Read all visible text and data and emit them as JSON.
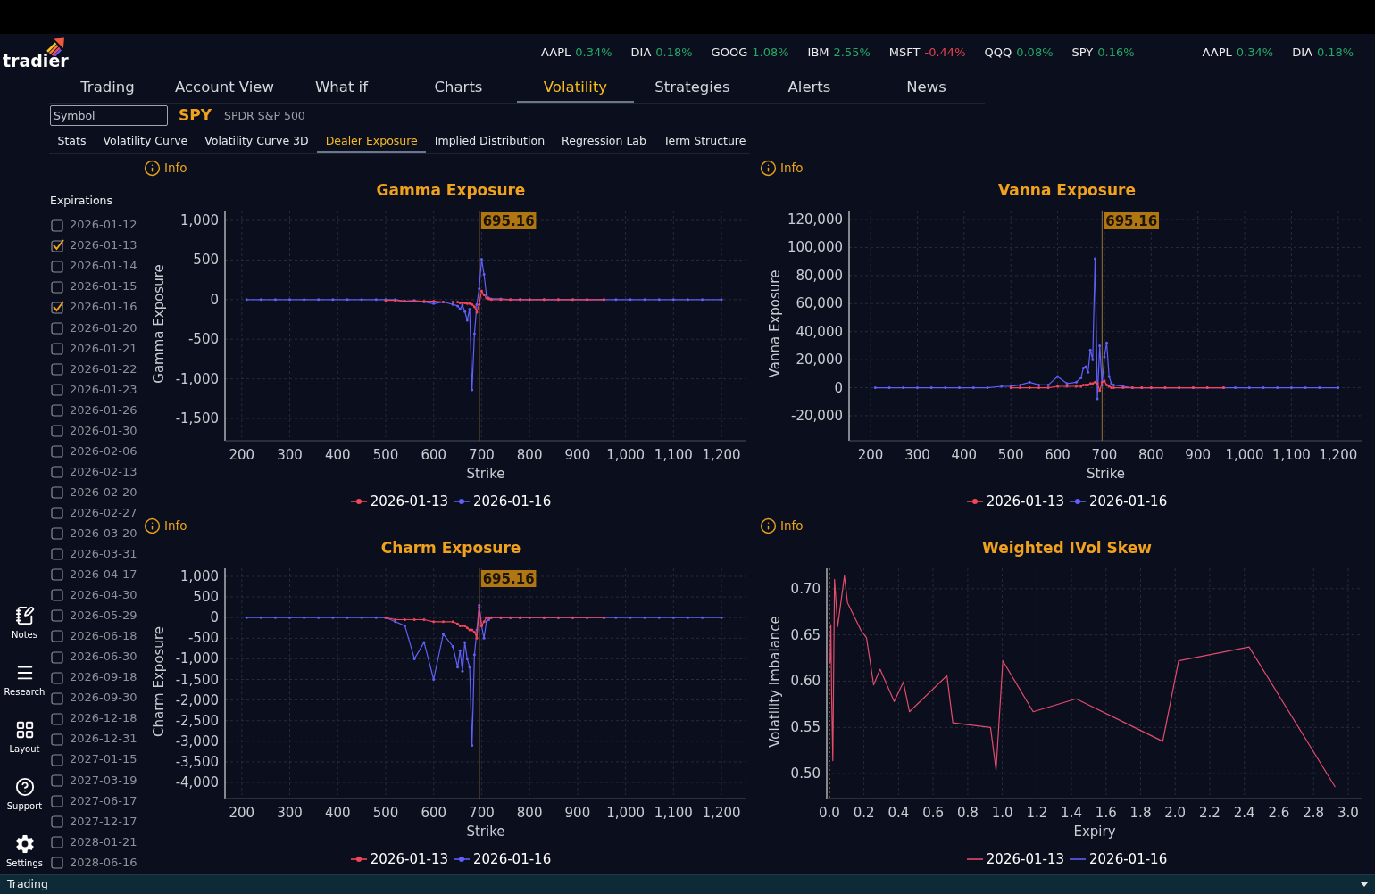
{
  "logo": {
    "text": "tradier"
  },
  "ticker_strip": {
    "runs": [
      {
        "items": [
          {
            "symbol": "AAPL",
            "change": "0.34%",
            "color": "#25a868"
          },
          {
            "symbol": "DIA",
            "change": "0.18%",
            "color": "#25a868"
          },
          {
            "symbol": "GOOG",
            "change": "1.08%",
            "color": "#25a868"
          },
          {
            "symbol": "IBM",
            "change": "2.55%",
            "color": "#25a868"
          },
          {
            "symbol": "MSFT",
            "change": "-0.44%",
            "color": "#e5404f"
          },
          {
            "symbol": "QQQ",
            "change": "0.08%",
            "color": "#25a868"
          },
          {
            "symbol": "SPY",
            "change": "0.16%",
            "color": "#25a868"
          }
        ]
      },
      {
        "items": [
          {
            "symbol": "AAPL",
            "change": "0.34%",
            "color": "#25a868"
          },
          {
            "symbol": "DIA",
            "change": "0.18%",
            "color": "#25a868"
          }
        ]
      }
    ]
  },
  "nav_tabs": [
    {
      "label": "Trading",
      "selected": false
    },
    {
      "label": "Account View",
      "selected": false
    },
    {
      "label": "What if",
      "selected": false
    },
    {
      "label": "Charts",
      "selected": false
    },
    {
      "label": "Volatility",
      "selected": true
    },
    {
      "label": "Strategies",
      "selected": false
    },
    {
      "label": "Alerts",
      "selected": false
    },
    {
      "label": "News",
      "selected": false
    }
  ],
  "symbol_search": {
    "placeholder": "Symbol"
  },
  "symbol": {
    "ticker": "SPY",
    "name": "SPDR S&P 500"
  },
  "sub_tabs": [
    {
      "label": "Stats",
      "selected": false
    },
    {
      "label": "Volatility Curve",
      "selected": false
    },
    {
      "label": "Volatility Curve 3D",
      "selected": false
    },
    {
      "label": "Dealer Exposure",
      "selected": true
    },
    {
      "label": "Implied Distribution",
      "selected": false
    },
    {
      "label": "Regression Lab",
      "selected": false
    },
    {
      "label": "Term Structure",
      "selected": false
    }
  ],
  "sidebar": {
    "items": [
      {
        "label": "Notes"
      },
      {
        "label": "Research"
      },
      {
        "label": "Layout"
      },
      {
        "label": "Support"
      },
      {
        "label": "Settings"
      }
    ]
  },
  "expirations": {
    "title": "Expirations",
    "items": [
      {
        "date": "2026-01-12",
        "checked": false
      },
      {
        "date": "2026-01-13",
        "checked": true
      },
      {
        "date": "2026-01-14",
        "checked": false
      },
      {
        "date": "2026-01-15",
        "checked": false
      },
      {
        "date": "2026-01-16",
        "checked": true
      },
      {
        "date": "2026-01-20",
        "checked": false
      },
      {
        "date": "2026-01-21",
        "checked": false
      },
      {
        "date": "2026-01-22",
        "checked": false
      },
      {
        "date": "2026-01-23",
        "checked": false
      },
      {
        "date": "2026-01-26",
        "checked": false
      },
      {
        "date": "2026-01-30",
        "checked": false
      },
      {
        "date": "2026-02-06",
        "checked": false
      },
      {
        "date": "2026-02-13",
        "checked": false
      },
      {
        "date": "2026-02-20",
        "checked": false
      },
      {
        "date": "2026-02-27",
        "checked": false
      },
      {
        "date": "2026-03-20",
        "checked": false
      },
      {
        "date": "2026-03-31",
        "checked": false
      },
      {
        "date": "2026-04-17",
        "checked": false
      },
      {
        "date": "2026-04-30",
        "checked": false
      },
      {
        "date": "2026-05-29",
        "checked": false
      },
      {
        "date": "2026-06-18",
        "checked": false
      },
      {
        "date": "2026-06-30",
        "checked": false
      },
      {
        "date": "2026-09-18",
        "checked": false
      },
      {
        "date": "2026-09-30",
        "checked": false
      },
      {
        "date": "2026-12-18",
        "checked": false
      },
      {
        "date": "2026-12-31",
        "checked": false
      },
      {
        "date": "2027-01-15",
        "checked": false
      },
      {
        "date": "2027-03-19",
        "checked": false
      },
      {
        "date": "2027-06-17",
        "checked": false
      },
      {
        "date": "2027-12-17",
        "checked": false
      },
      {
        "date": "2028-01-21",
        "checked": false
      },
      {
        "date": "2028-06-16",
        "checked": false
      }
    ]
  },
  "panels": [
    {
      "kind": "exposure",
      "info_label": "Info",
      "chart_data": {
        "type": "line",
        "title": "Gamma Exposure",
        "xlabel": "Strike",
        "ylabel": "Gamma Exposure",
        "x": [
          210,
          240,
          270,
          300,
          330,
          360,
          390,
          420,
          450,
          480,
          500,
          520,
          540,
          560,
          580,
          600,
          620,
          640,
          650,
          655,
          660,
          665,
          670,
          675,
          680,
          685,
          690,
          695,
          700,
          705,
          710,
          715,
          720,
          740,
          760,
          780,
          800,
          830,
          860,
          890,
          920,
          955,
          980,
          1010,
          1040,
          1070,
          1100,
          1130,
          1160,
          1200
        ],
        "series": [
          {
            "name": "2026-01-13",
            "color": "#f2465b",
            "values": [
              null,
              null,
              null,
              null,
              null,
              null,
              null,
              null,
              null,
              null,
              -10,
              -10,
              -20,
              -20,
              -20,
              -20,
              -30,
              -30,
              -30,
              -40,
              -40,
              -40,
              -50,
              -50,
              -60,
              -90,
              -160,
              -60,
              110,
              60,
              20,
              10,
              0,
              0,
              0,
              0,
              0,
              0,
              0,
              0,
              0,
              0,
              null,
              null,
              null,
              null,
              null,
              null,
              null,
              null
            ]
          },
          {
            "name": "2026-01-16",
            "color": "#6060f7",
            "values": [
              0,
              0,
              0,
              0,
              0,
              0,
              0,
              0,
              0,
              0,
              0,
              0,
              -20,
              -10,
              -30,
              -50,
              -30,
              -60,
              -80,
              -120,
              -70,
              -150,
              -260,
              -120,
              -1140,
              -430,
              -60,
              140,
              510,
              320,
              60,
              20,
              10,
              10,
              0,
              0,
              0,
              0,
              0,
              0,
              0,
              0,
              0,
              0,
              0,
              0,
              0,
              0,
              0,
              0
            ]
          }
        ],
        "xlim": [
          165,
          1252
        ],
        "ylim": [
          -1736,
          1124
        ],
        "xticks": [
          200,
          300,
          400,
          500,
          600,
          700,
          800,
          900,
          {
            "value": 1000,
            "label": "1,000"
          },
          {
            "value": 1100,
            "label": "1,100"
          },
          {
            "value": 1200,
            "label": "1,200"
          }
        ],
        "yticks": [
          {
            "value": 1000,
            "label": "1,000"
          },
          500,
          0,
          -500,
          {
            "value": -1000,
            "label": "-1,000"
          },
          {
            "value": -1500,
            "label": "-1,500"
          }
        ],
        "grid": true,
        "ref_lines": [
          {
            "axis": "x",
            "value": 695.16,
            "label": "695.16"
          }
        ]
      }
    },
    {
      "kind": "exposure",
      "info_label": "Info",
      "chart_data": {
        "type": "line",
        "title": "Vanna Exposure",
        "xlabel": "Strike",
        "ylabel": "Vanna Exposure",
        "x": [
          210,
          240,
          270,
          300,
          330,
          360,
          390,
          420,
          450,
          480,
          500,
          520,
          540,
          560,
          580,
          600,
          620,
          640,
          650,
          655,
          660,
          665,
          670,
          675,
          680,
          685,
          690,
          695,
          700,
          705,
          710,
          715,
          720,
          740,
          760,
          780,
          800,
          830,
          860,
          890,
          920,
          955,
          980,
          1010,
          1040,
          1070,
          1100,
          1130,
          1160,
          1200
        ],
        "series": [
          {
            "name": "2026-01-13",
            "color": "#f2465b",
            "values": [
              null,
              null,
              null,
              null,
              null,
              null,
              null,
              null,
              null,
              null,
              0,
              0,
              0,
              0,
              0,
              1000,
              1000,
              1000,
              1000,
              2000,
              2000,
              2000,
              3000,
              3000,
              4000,
              3000,
              -2000,
              4000,
              5000,
              2000,
              1000,
              0,
              0,
              0,
              0,
              0,
              0,
              0,
              0,
              0,
              0,
              0,
              null,
              null,
              null,
              null,
              null,
              null,
              null,
              null
            ]
          },
          {
            "name": "2026-01-16",
            "color": "#6060f7",
            "values": [
              0,
              0,
              0,
              0,
              0,
              0,
              0,
              0,
              0,
              1000,
              1000,
              2000,
              4000,
              2000,
              2000,
              8000,
              3000,
              4000,
              7000,
              14000,
              15000,
              11000,
              27000,
              20000,
              92000,
              -8000,
              30000,
              2000,
              22000,
              32000,
              8000,
              3000,
              2000,
              1000,
              0,
              0,
              0,
              0,
              0,
              0,
              0,
              0,
              0,
              0,
              0,
              0,
              0,
              0,
              0,
              0
            ]
          }
        ],
        "xlim": [
          154,
          1252
        ],
        "ylim": [
          -35290,
          126370
        ],
        "xticks": [
          200,
          300,
          400,
          500,
          600,
          700,
          800,
          900,
          {
            "value": 1000,
            "label": "1,000"
          },
          {
            "value": 1100,
            "label": "1,100"
          },
          {
            "value": 1200,
            "label": "1,200"
          }
        ],
        "yticks": [
          {
            "value": 120000,
            "label": "120,000"
          },
          {
            "value": 100000,
            "label": "100,000"
          },
          {
            "value": 80000,
            "label": "80,000"
          },
          {
            "value": 60000,
            "label": "60,000"
          },
          {
            "value": 40000,
            "label": "40,000"
          },
          {
            "value": 20000,
            "label": "20,000"
          },
          0,
          {
            "value": -20000,
            "label": "-20,000"
          }
        ],
        "grid": true,
        "ref_lines": [
          {
            "axis": "x",
            "value": 695.16,
            "label": "695.16"
          }
        ]
      }
    },
    {
      "kind": "exposure",
      "info_label": "Info",
      "chart_data": {
        "type": "line",
        "title": "Charm Exposure",
        "xlabel": "Strike",
        "ylabel": "Charm Exposure",
        "x": [
          210,
          240,
          270,
          300,
          330,
          360,
          390,
          420,
          450,
          480,
          500,
          520,
          540,
          560,
          580,
          600,
          620,
          640,
          650,
          655,
          660,
          665,
          670,
          675,
          680,
          685,
          690,
          695,
          700,
          705,
          710,
          715,
          720,
          740,
          760,
          780,
          800,
          830,
          860,
          890,
          920,
          955,
          980,
          1010,
          1040,
          1070,
          1100,
          1130,
          1160,
          1200
        ],
        "series": [
          {
            "name": "2026-01-13",
            "color": "#f2465b",
            "values": [
              null,
              null,
              null,
              null,
              null,
              null,
              null,
              null,
              null,
              null,
              0,
              -50,
              -50,
              -50,
              -50,
              -100,
              -100,
              -100,
              -150,
              -200,
              -200,
              -200,
              -250,
              -300,
              -300,
              -350,
              -500,
              250,
              -200,
              -100,
              0,
              0,
              0,
              0,
              0,
              0,
              0,
              0,
              0,
              0,
              0,
              0,
              null,
              null,
              null,
              null,
              null,
              null,
              null,
              null
            ]
          },
          {
            "name": "2026-01-16",
            "color": "#6060f7",
            "values": [
              0,
              0,
              0,
              0,
              0,
              0,
              0,
              0,
              0,
              0,
              0,
              -100,
              -200,
              -1000,
              -600,
              -1500,
              -400,
              -700,
              -1200,
              -800,
              -1300,
              -600,
              -1000,
              -1200,
              -3100,
              -900,
              -300,
              300,
              -200,
              -500,
              -100,
              -50,
              0,
              0,
              0,
              0,
              0,
              0,
              0,
              0,
              0,
              0,
              0,
              0,
              0,
              0,
              0,
              0,
              0,
              0
            ]
          }
        ],
        "xlim": [
          165,
          1252
        ],
        "ylim": [
          -4303,
          1195
        ],
        "xticks": [
          200,
          300,
          400,
          500,
          600,
          700,
          800,
          900,
          {
            "value": 1000,
            "label": "1,000"
          },
          {
            "value": 1100,
            "label": "1,100"
          },
          {
            "value": 1200,
            "label": "1,200"
          }
        ],
        "yticks": [
          {
            "value": 1000,
            "label": "1,000"
          },
          500,
          0,
          -500,
          {
            "value": -1000,
            "label": "-1,000"
          },
          {
            "value": -1500,
            "label": "-1,500"
          },
          {
            "value": -2000,
            "label": "-2,000"
          },
          {
            "value": -2500,
            "label": "-2,500"
          },
          {
            "value": -3000,
            "label": "-3,000"
          },
          {
            "value": -3500,
            "label": "-3,500"
          },
          {
            "value": -4000,
            "label": "-4,000"
          }
        ],
        "grid": true,
        "ref_lines": [
          {
            "axis": "x",
            "value": 695.16,
            "label": "695.16"
          }
        ]
      }
    },
    {
      "kind": "skew",
      "info_label": "Info",
      "chart_data": {
        "type": "line",
        "title": "Weighted IVol Skew",
        "xlabel": "Expiry",
        "ylabel": "Volatility Imbalance",
        "x": [
          0.004,
          0.009,
          0.013,
          0.02,
          0.03,
          0.048,
          0.087,
          0.105,
          0.183,
          0.215,
          0.256,
          0.293,
          0.375,
          0.428,
          0.463,
          0.68,
          0.714,
          0.932,
          0.964,
          1.003,
          1.179,
          1.427,
          1.928,
          2.02,
          2.427,
          2.924
        ],
        "series": [
          {
            "name": "2026-01-13",
            "color": "#e24c6d",
            "values": [
              0.62,
              0.661,
              0.588,
              0.514,
              0.71,
              0.659,
              0.714,
              0.685,
              0.655,
              0.647,
              0.596,
              0.613,
              0.578,
              0.599,
              0.567,
              0.606,
              0.555,
              0.55,
              0.504,
              0.622,
              0.567,
              0.581,
              0.535,
              0.622,
              0.637,
              0.486
            ]
          },
          {
            "name": "2026-01-16",
            "color": "#6060f7",
            "values": [
              null,
              null,
              null,
              null,
              null,
              null,
              null,
              null,
              null,
              null,
              null,
              null,
              null,
              null,
              null,
              null,
              null,
              null,
              null,
              null,
              null,
              null,
              null,
              null,
              null,
              null
            ]
          }
        ],
        "xlim": [
          -0.015,
          3.083
        ],
        "ylim": [
          0.477,
          0.722
        ],
        "xticks": [
          {
            "value": 0,
            "label": "0.0"
          },
          0.2,
          0.4,
          0.6,
          0.8,
          {
            "value": 1,
            "label": "1.0"
          },
          1.2,
          1.4,
          1.6,
          1.8,
          {
            "value": 2,
            "label": "2.0"
          },
          2.2,
          2.4,
          2.6,
          2.8,
          {
            "value": 3,
            "label": "3.0"
          }
        ],
        "yticks": [
          {
            "value": 0.5,
            "label": "0.50"
          },
          0.55,
          {
            "value": 0.6,
            "label": "0.60"
          },
          0.65,
          {
            "value": 0.7,
            "label": "0.70"
          }
        ],
        "grid": true,
        "ref_lines": [
          {
            "axis": "x",
            "value": 0
          }
        ]
      }
    }
  ],
  "status_bar": {
    "label": "Trading"
  }
}
